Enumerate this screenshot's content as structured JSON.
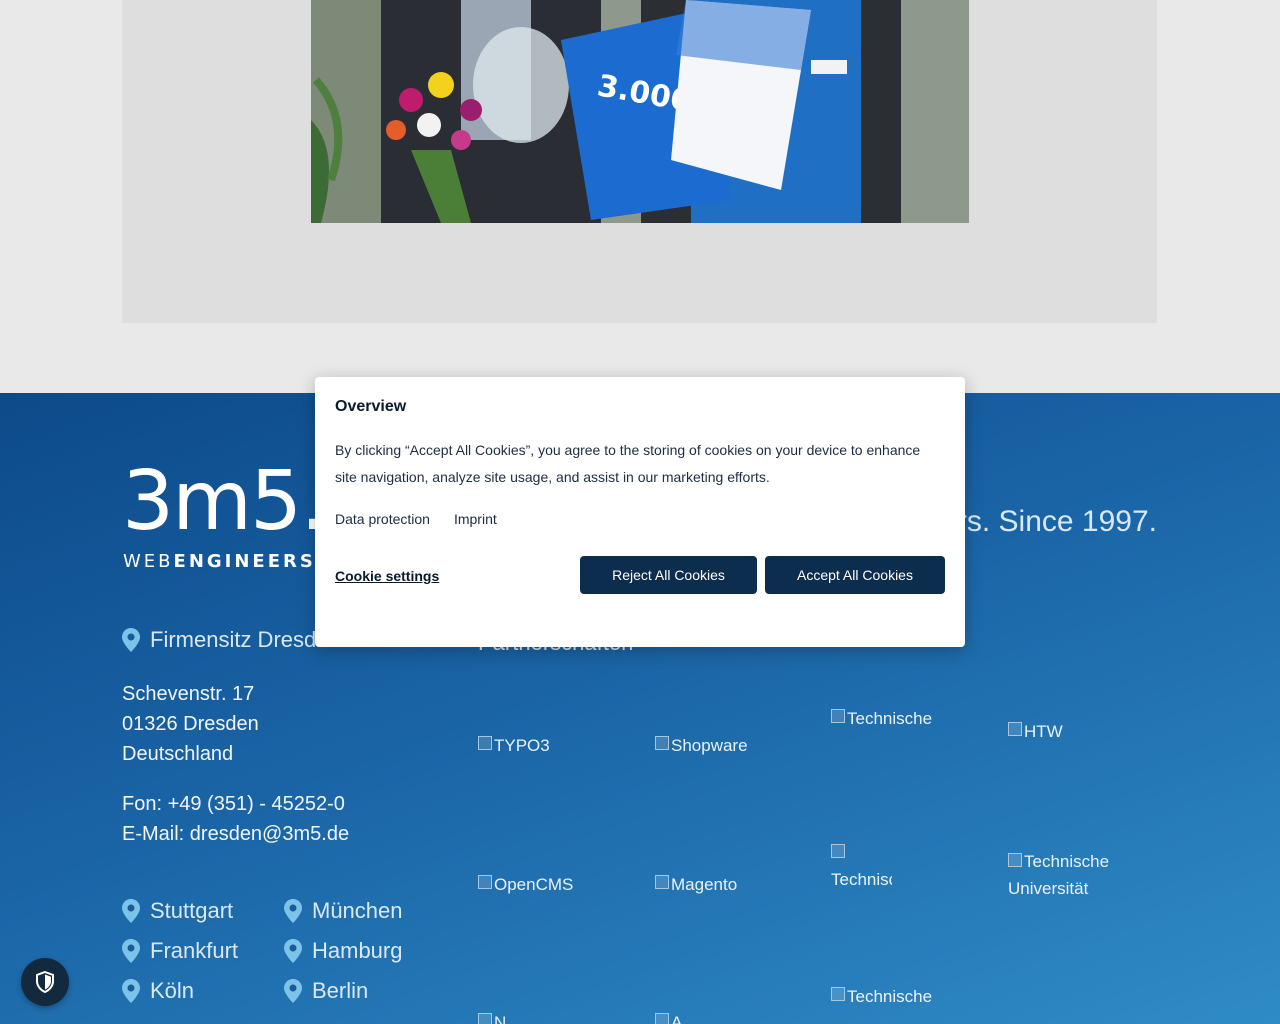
{
  "hero": {
    "image_alt": "3m5. Excellence Award ceremony photo"
  },
  "footer": {
    "logo_text": "3m5.",
    "logo_sub_light": "WEB",
    "logo_sub_bold": "ENGINEERS",
    "tagline": "rs. Since 1997.",
    "hq": {
      "label": "Firmensitz Dresden",
      "street": "Schevenstr. 17",
      "city": "01326 Dresden",
      "country": "Deutschland",
      "phone": "Fon: +49 (351) - 45252-0",
      "email": "E-Mail: dresden@3m5.de"
    },
    "locations": [
      "Stuttgart",
      "München",
      "Frankfurt",
      "Hamburg",
      "Köln",
      "Berlin"
    ],
    "partners_title": "Partnerschaften",
    "partners": [
      "TYPO3",
      "Shopware",
      "Technische",
      "HTW",
      "OpenCMS",
      "Magento",
      "Technische Universi",
      "Technische Universität",
      "N",
      "A",
      "Technische"
    ]
  },
  "cookie_dialog": {
    "title": "Overview",
    "text": "By clicking “Accept All Cookies”, you agree to the storing of cookies on your device to enhance site navigation, analyze site usage, and assist in our marketing efforts.",
    "link_data_protection": "Data protection",
    "link_imprint": "Imprint",
    "settings_label": "Cookie settings",
    "reject_label": "Reject All Cookies",
    "accept_label": "Accept All Cookies"
  },
  "colors": {
    "footer_start": "#0d4a8a",
    "footer_end": "#2f8bc6",
    "button": "#0d2d4e",
    "pin": "#7cc3ea"
  },
  "icons": {
    "pin": "map-pin-icon",
    "shield": "shield-icon"
  }
}
